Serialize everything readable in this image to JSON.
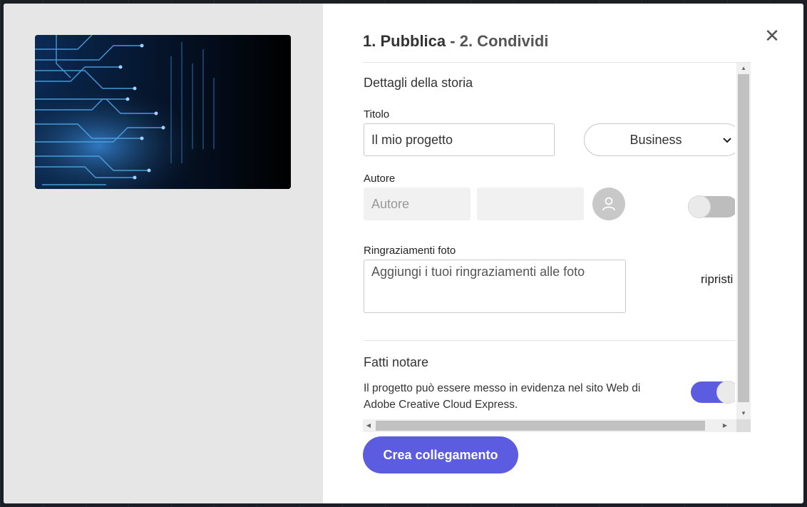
{
  "dialog": {
    "heading_step1": "1. Pubblica",
    "heading_sep": " - ",
    "heading_step2": "2. Condividi",
    "close_icon": "close-icon"
  },
  "story_details": {
    "section_title": "Dettagli della storia",
    "title_label": "Titolo",
    "title_value": "Il mio progetto",
    "category_value": "Business",
    "author_label": "Autore",
    "author_placeholder": "Autore",
    "author_second_value": "",
    "avatar_icon": "user-icon",
    "photo_credits_label": "Ringraziamenti foto",
    "photo_credits_placeholder": "Aggiungi i tuoi ringraziamenti alle foto",
    "reset_label": "ripristi"
  },
  "featured": {
    "section_title": "Fatti notare",
    "description": "Il progetto può essere messo in evidenza nel sito Web di Adobe Creative Cloud Express.",
    "toggle_on": true
  },
  "actions": {
    "create_link_label": "Crea collegamento"
  },
  "colors": {
    "accent": "#5c5ce0",
    "left_pane": "#e6e6e6"
  }
}
